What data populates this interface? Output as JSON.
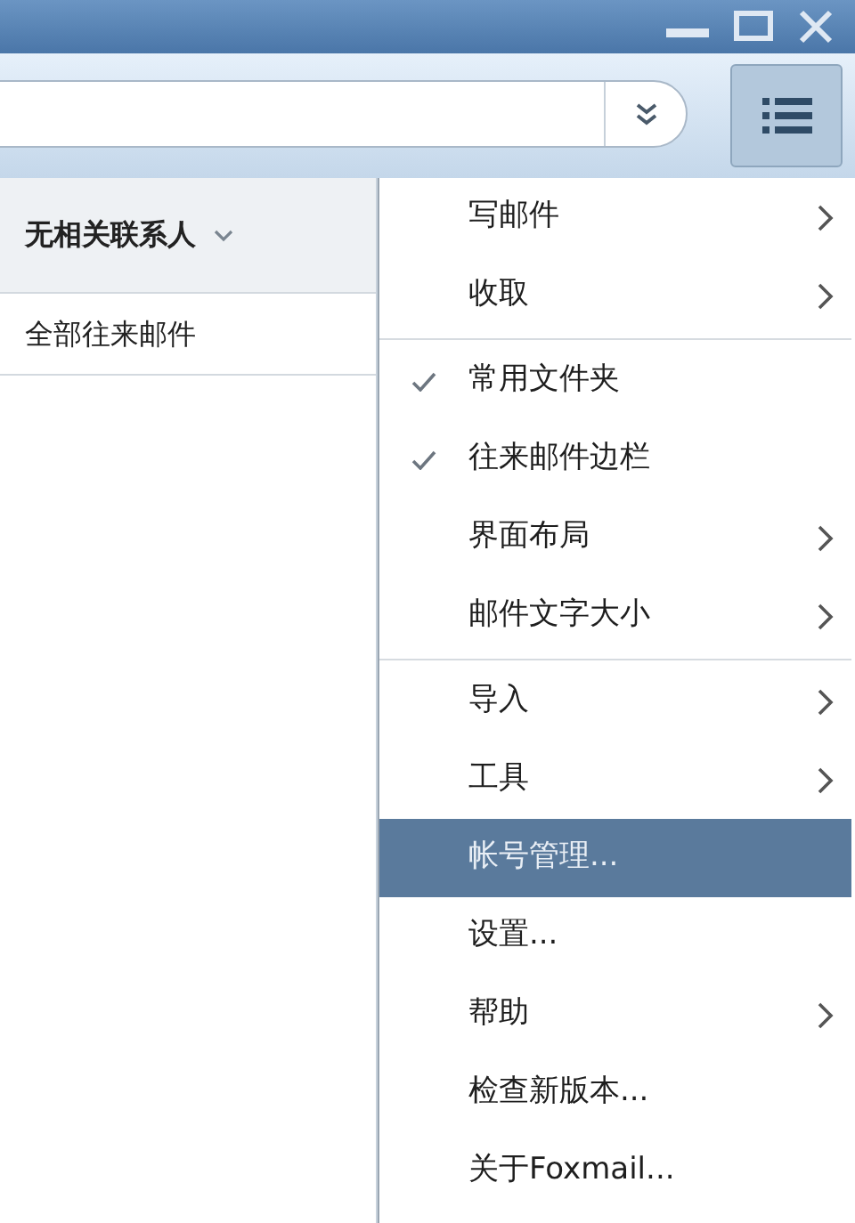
{
  "contact_panel": {
    "header": "无相关联系人",
    "rows": [
      {
        "label": "全部往来邮件"
      }
    ]
  },
  "menu": {
    "items": [
      {
        "kind": "item",
        "label": "写邮件",
        "checked": false,
        "submenu": true,
        "selected": false
      },
      {
        "kind": "item",
        "label": "收取",
        "checked": false,
        "submenu": true,
        "selected": false
      },
      {
        "kind": "separator"
      },
      {
        "kind": "item",
        "label": "常用文件夹",
        "checked": true,
        "submenu": false,
        "selected": false
      },
      {
        "kind": "item",
        "label": "往来邮件边栏",
        "checked": true,
        "submenu": false,
        "selected": false
      },
      {
        "kind": "item",
        "label": "界面布局",
        "checked": false,
        "submenu": true,
        "selected": false
      },
      {
        "kind": "item",
        "label": "邮件文字大小",
        "checked": false,
        "submenu": true,
        "selected": false
      },
      {
        "kind": "separator"
      },
      {
        "kind": "item",
        "label": "导入",
        "checked": false,
        "submenu": true,
        "selected": false
      },
      {
        "kind": "item",
        "label": "工具",
        "checked": false,
        "submenu": true,
        "selected": false
      },
      {
        "kind": "item",
        "label": "帐号管理...",
        "checked": false,
        "submenu": false,
        "selected": true
      },
      {
        "kind": "item",
        "label": "设置...",
        "checked": false,
        "submenu": false,
        "selected": false
      },
      {
        "kind": "item",
        "label": "帮助",
        "checked": false,
        "submenu": true,
        "selected": false
      },
      {
        "kind": "item",
        "label": "检查新版本...",
        "checked": false,
        "submenu": false,
        "selected": false
      },
      {
        "kind": "item",
        "label": "关于Foxmail...",
        "checked": false,
        "submenu": false,
        "selected": false
      }
    ]
  }
}
